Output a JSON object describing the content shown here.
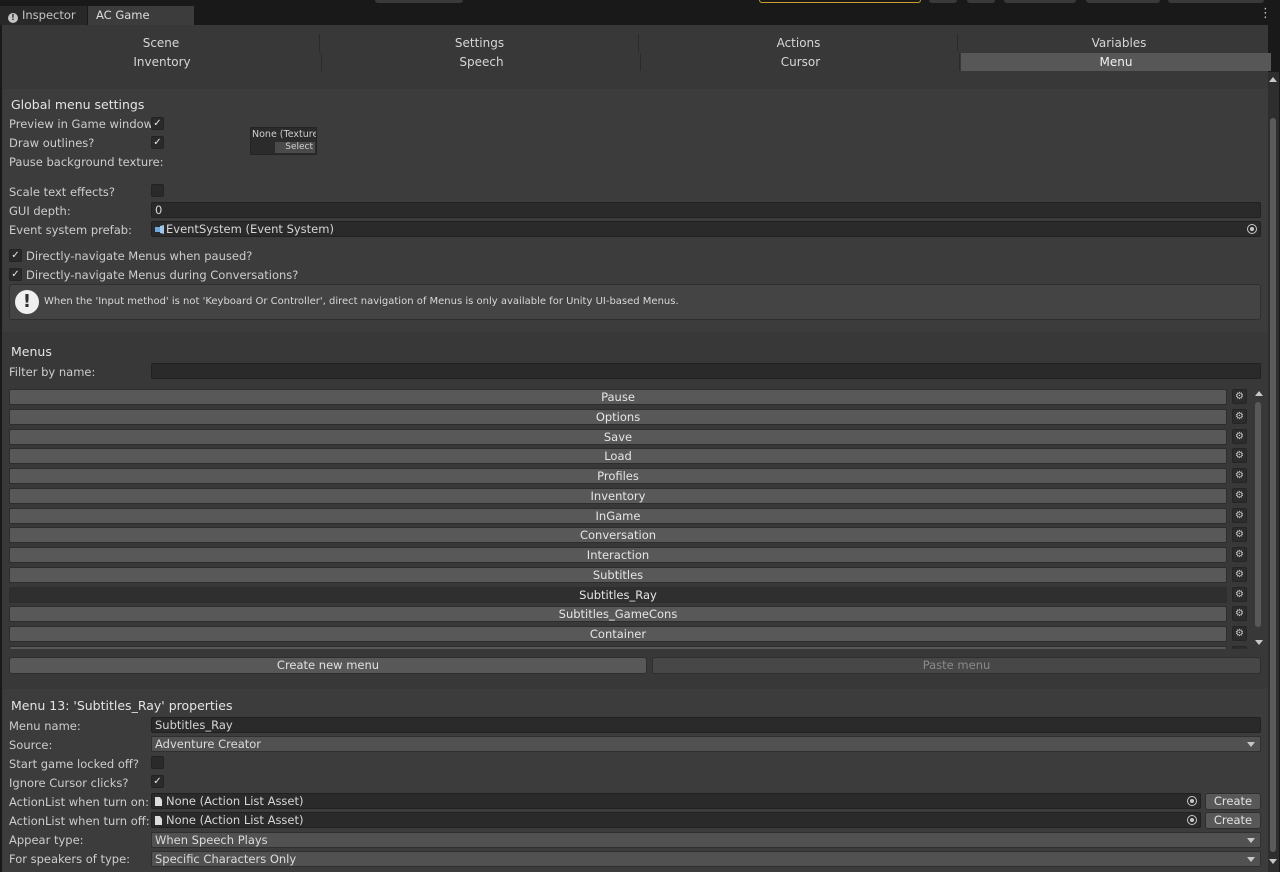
{
  "window": {
    "tabs": [
      {
        "label": "Inspector",
        "icon": "info-icon"
      },
      {
        "label": "AC Game Editor"
      }
    ],
    "more_icon": "kebab-menu-icon"
  },
  "section_tabs": {
    "row1": [
      "Scene",
      "Settings",
      "Actions",
      "Variables"
    ],
    "row2": [
      "Inventory",
      "Speech",
      "Cursor",
      "Menu"
    ],
    "selected": "Menu"
  },
  "global": {
    "header": "Global menu settings",
    "preview_label": "Preview in Game window?",
    "preview_checked": true,
    "outlines_label": "Draw outlines?",
    "outlines_checked": true,
    "pause_tex_label": "Pause background texture:",
    "pause_tex_value": "None (Texture",
    "pause_tex_select": "Select",
    "scale_label": "Scale text effects?",
    "scale_checked": false,
    "depth_label": "GUI depth:",
    "depth_value": "0",
    "event_label": "Event system prefab:",
    "event_value": "EventSystem (Event System)",
    "nav_paused_label": "Directly-navigate Menus when paused?",
    "nav_paused_checked": true,
    "nav_conv_label": "Directly-navigate Menus during Conversations?",
    "nav_conv_checked": true,
    "help_text": "When the 'Input method' is not 'Keyboard Or Controller', direct navigation of Menus is only available for Unity UI-based Menus."
  },
  "menus": {
    "header": "Menus",
    "filter_label": "Filter by name:",
    "filter_value": "",
    "items": [
      "Pause",
      "Options",
      "Save",
      "Load",
      "Profiles",
      "Inventory",
      "InGame",
      "Conversation",
      "Interaction",
      "Subtitles",
      "Subtitles_Ray",
      "Subtitles_GameCons",
      "Container"
    ],
    "selected": "Subtitles_Ray",
    "gear_icon": "gear-icon",
    "create_label": "Create new menu",
    "paste_label": "Paste menu"
  },
  "props": {
    "header": "Menu 13: 'Subtitles_Ray' properties",
    "name_label": "Menu name:",
    "name_value": "Subtitles_Ray",
    "source_label": "Source:",
    "source_value": "Adventure Creator",
    "locked_label": "Start game locked off?",
    "locked_checked": false,
    "ignore_label": "Ignore Cursor clicks?",
    "ignore_checked": true,
    "on_label": "ActionList when turn on:",
    "on_value": "None (Action List Asset)",
    "off_label": "ActionList when turn off:",
    "off_value": "None (Action List Asset)",
    "create_label": "Create",
    "appear_label": "Appear type:",
    "appear_value": "When Speech Plays",
    "speakers_label": "For speakers of type:",
    "speakers_value": "Specific Characters Only"
  }
}
